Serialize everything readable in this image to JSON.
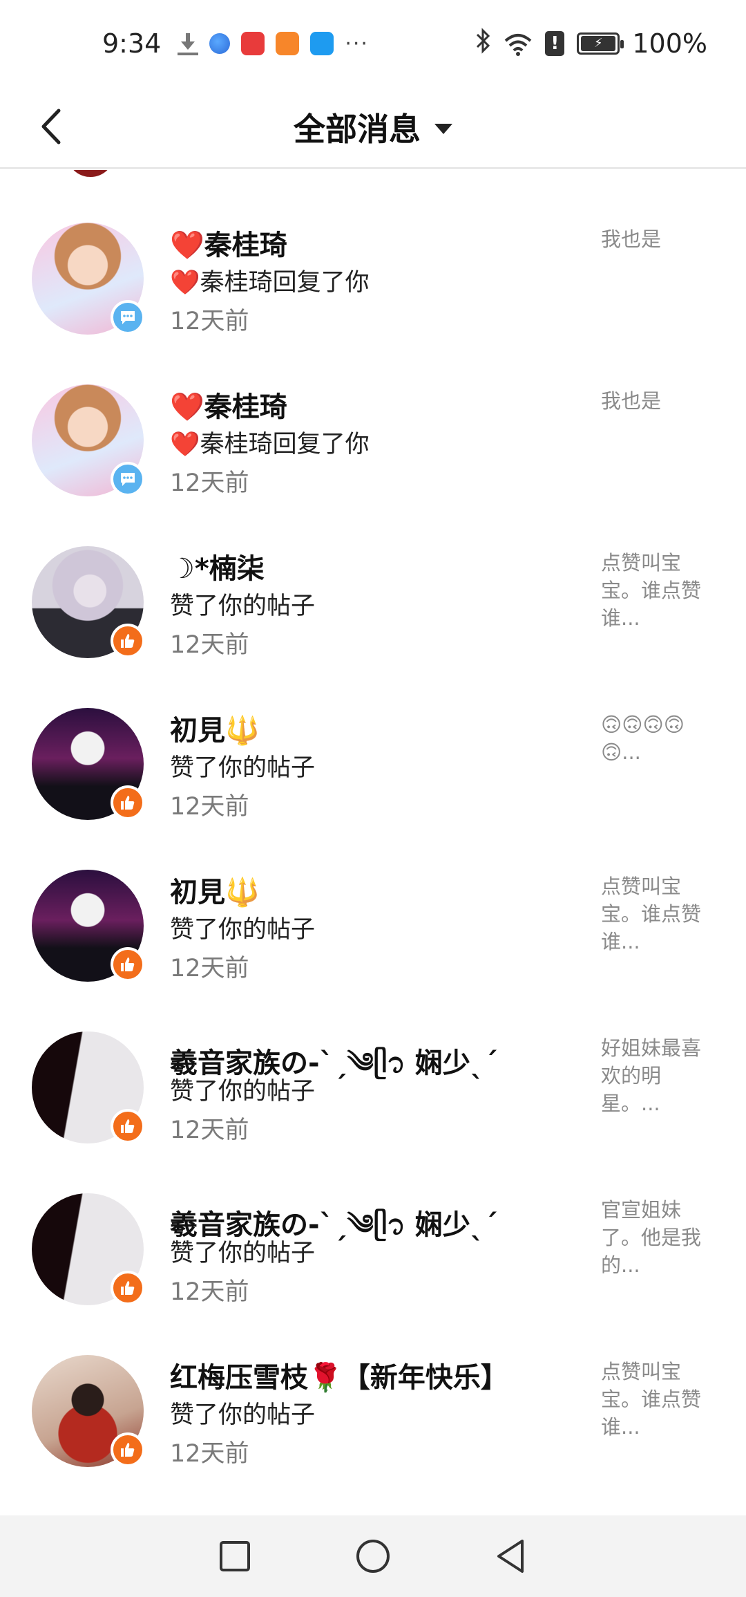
{
  "status_bar": {
    "time": "9:34",
    "dots": "···",
    "battery_text": "100%"
  },
  "header": {
    "title": "全部消息"
  },
  "messages": [
    {
      "name": "❤️秦桂琦",
      "action": "❤️秦桂琦回复了你",
      "time": "12天前",
      "preview": "我也是",
      "badge": "comment-icon"
    },
    {
      "name": "❤️秦桂琦",
      "action": "❤️秦桂琦回复了你",
      "time": "12天前",
      "preview": "我也是",
      "badge": "comment-icon"
    },
    {
      "name": "☽*楠柒",
      "action": "赞了你的帖子",
      "time": "12天前",
      "preview": "点赞叫宝宝。谁点赞谁...",
      "badge": "like-icon"
    },
    {
      "name": "初見🔱",
      "action": "赞了你的帖子",
      "time": "12天前",
      "preview": "🙃🙃🙃🙃🙃...",
      "badge": "like-icon"
    },
    {
      "name": "初見🔱",
      "action": "赞了你的帖子",
      "time": "12天前",
      "preview": "点赞叫宝宝。谁点赞谁...",
      "badge": "like-icon"
    },
    {
      "name": "羲音家族の-ˋˏ༄ᥫ᭡ 娴少ˎˊ",
      "action": "赞了你的帖子",
      "time": "12天前",
      "preview": "好姐妹最喜欢的明星。...",
      "badge": "like-icon"
    },
    {
      "name": "羲音家族の-ˋˏ༄ᥫ᭡ 娴少ˎˊ",
      "action": "赞了你的帖子",
      "time": "12天前",
      "preview": "官宣姐妹了。他是我的...",
      "badge": "like-icon"
    },
    {
      "name": "红梅压雪枝🌹【新年快乐】",
      "action": "赞了你的帖子",
      "time": "12天前",
      "preview": "点赞叫宝宝。谁点赞谁...",
      "badge": "like-icon"
    }
  ],
  "colors": {
    "like_badge": "#f36d1a",
    "comment_badge": "#5ab3f0",
    "time_text": "#7a7a7a",
    "preview_text": "#8a8a8a"
  }
}
